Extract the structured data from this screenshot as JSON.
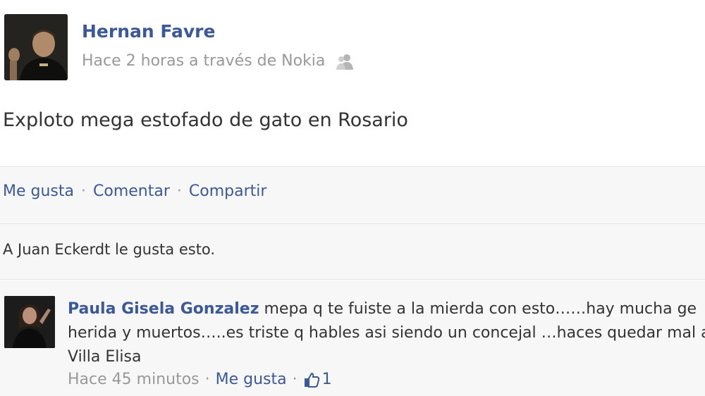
{
  "post": {
    "author": "Hernan Favre",
    "meta": "Hace 2 horas a través de Nokia",
    "text": "Exploto mega estofado de gato en Rosario",
    "actions": {
      "like": "Me gusta",
      "comment": "Comentar",
      "share": "Compartir",
      "separator": "·"
    },
    "likes_text": "A Juan Eckerdt le gusta esto.",
    "privacy_icon": "friends-icon"
  },
  "comment": {
    "author": "Paula Gisela Gonzalez",
    "text_line1": "mepa q te fuiste a la mierda con esto……hay mucha ge",
    "text_line2": "herida y muertos…..es triste q hables asi siendo un concejal …haces quedar mal a",
    "text_line3": "Villa Elisa",
    "time": "Hace 45 minutos",
    "like_label": "Me gusta",
    "separator": "·",
    "like_count": "1",
    "like_icon": "thumbs-up-icon"
  },
  "colors": {
    "link": "#3b5998",
    "muted": "#999999",
    "text": "#333333",
    "bar_bg": "#f7f7f7"
  }
}
